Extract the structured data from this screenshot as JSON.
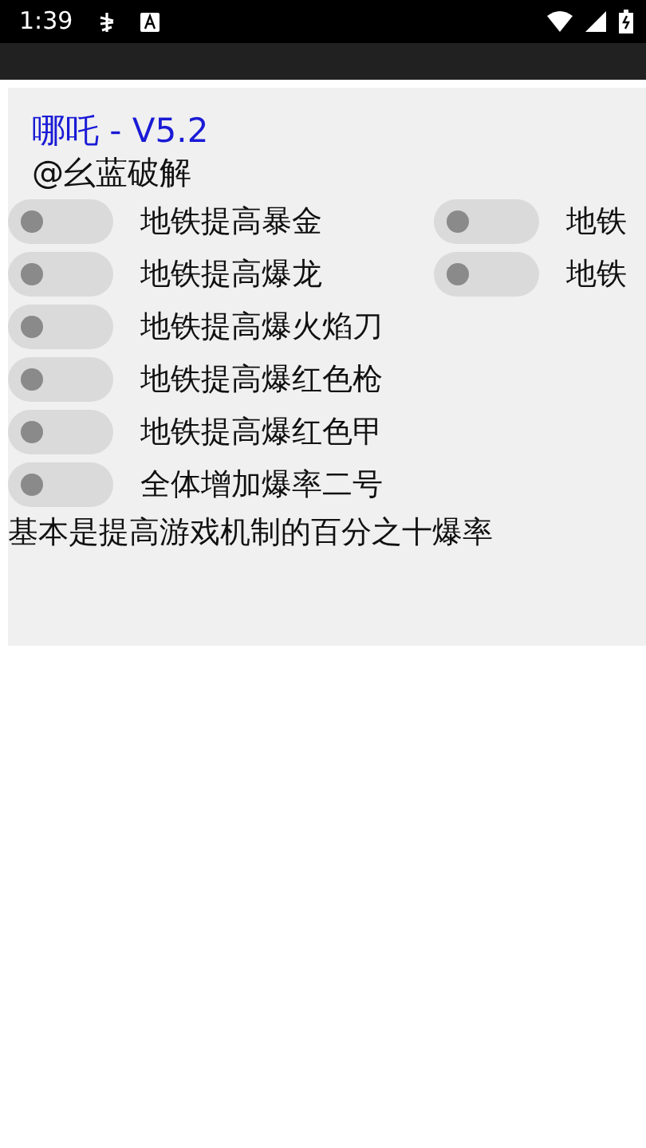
{
  "status_bar": {
    "time": "1:39"
  },
  "panel": {
    "title": "哪吒 - V5.2",
    "author": "@幺蓝破解",
    "switches": [
      {
        "label": "地铁提高暴金",
        "on": false
      },
      {
        "label": "地铁",
        "on": false
      },
      {
        "label": "地铁提高爆龙",
        "on": false
      },
      {
        "label": "地铁",
        "on": false
      },
      {
        "label": "地铁提高爆火焰刀",
        "on": false
      },
      {
        "label": "地铁提高爆红色枪",
        "on": false
      },
      {
        "label": "地铁提高爆红色甲",
        "on": false
      },
      {
        "label": "全体增加爆率二号",
        "on": false
      }
    ],
    "note": "基本是提高游戏机制的百分之十爆率"
  }
}
